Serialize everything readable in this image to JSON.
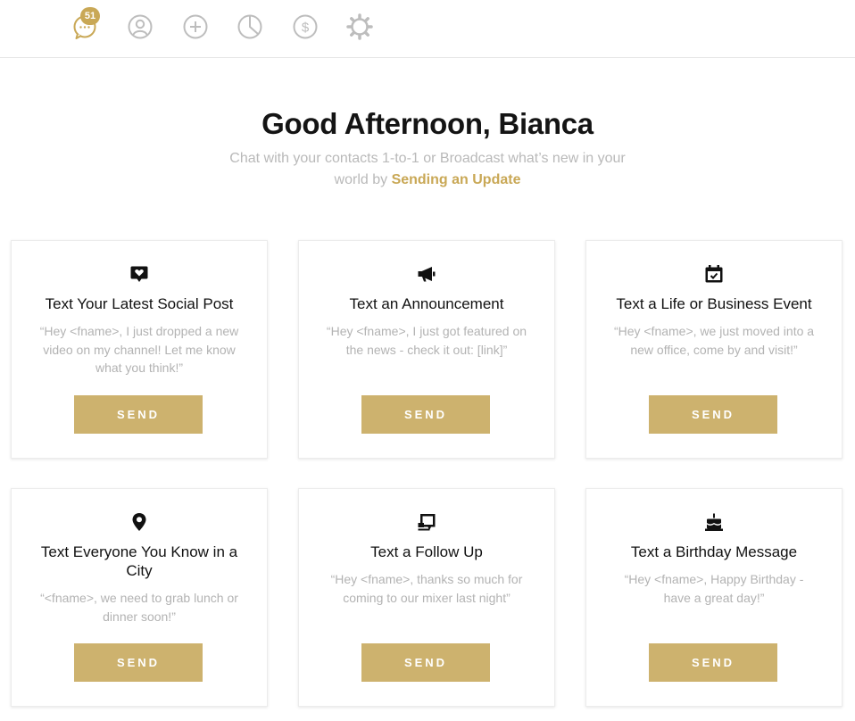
{
  "nav": {
    "items": [
      {
        "icon": "chat-icon",
        "badge": "51"
      },
      {
        "icon": "user-icon"
      },
      {
        "icon": "plus-icon"
      },
      {
        "icon": "pie-chart-icon"
      },
      {
        "icon": "dollar-icon"
      },
      {
        "icon": "gear-icon"
      }
    ]
  },
  "hero": {
    "greeting": "Good Afternoon, Bianca",
    "subtitle_text": "Chat with your contacts 1-to-1 or Broadcast what’s new in your world by ",
    "subtitle_link": "Sending an Update"
  },
  "cards": [
    {
      "icon": "heart-bubble-icon",
      "title": "Text Your Latest Social Post",
      "quote": "“Hey <fname>, I just dropped a new video on my channel! Let me know what you think!”",
      "button": "SEND"
    },
    {
      "icon": "megaphone-icon",
      "title": "Text an Announcement",
      "quote": "“Hey <fname>, I just got featured on the news - check it out: [link]”",
      "button": "SEND"
    },
    {
      "icon": "calendar-check-icon",
      "title": "Text a Life or Business Event",
      "quote": "“Hey <fname>, we just moved into a new office, come by and visit!”",
      "button": "SEND"
    },
    {
      "icon": "location-pin-icon",
      "title": "Text Everyone You Know in a City",
      "quote": "“<fname>, we need to grab lunch or dinner soon!”",
      "button": "SEND"
    },
    {
      "icon": "follow-up-icon",
      "title": "Text a Follow Up",
      "quote": "“Hey <fname>, thanks so much for coming to our mixer last night”",
      "button": "SEND"
    },
    {
      "icon": "birthday-cake-icon",
      "title": "Text a Birthday Message",
      "quote": "“Hey <fname>, Happy Birthday - have a great day!”",
      "button": "SEND"
    }
  ],
  "colors": {
    "accent": "#c9a856",
    "button": "#cdb26e",
    "muted_text": "#b3b3b3",
    "nav_icon": "#bdbdbd"
  }
}
